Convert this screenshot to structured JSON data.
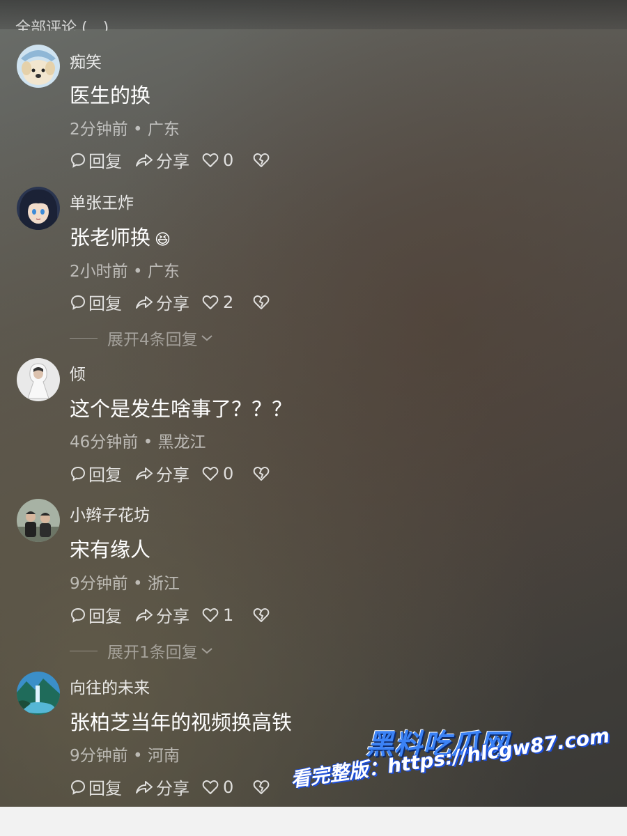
{
  "header": {
    "partial_text": "全部评论 (…)"
  },
  "actions": {
    "reply_label": "回复",
    "share_label": "分享"
  },
  "comments": [
    {
      "username": "痴笑",
      "content": "医生的换",
      "time": "2分钟前",
      "location": "广东",
      "likes": "0",
      "avatar": "dog-avatar"
    },
    {
      "username": "单张王炸",
      "content": "张老师换",
      "time": "2小时前",
      "location": "广东",
      "likes": "2",
      "avatar": "anime-avatar",
      "emoji": "😆",
      "expand_label": "展开4条回复"
    },
    {
      "username": "倾",
      "content": "这个是发生啥事了？？？",
      "time": "46分钟前",
      "location": "黑龙江",
      "likes": "0",
      "avatar": "figure-avatar"
    },
    {
      "username": "小辫子花坊",
      "content": "宋有缘人",
      "time": "9分钟前",
      "location": "浙江",
      "likes": "1",
      "avatar": "kids-avatar",
      "expand_label": "展开1条回复"
    },
    {
      "username": "向往的未来",
      "content": "张柏芝当年的视频换高铁",
      "time": "9分钟前",
      "location": "河南",
      "likes": "0",
      "avatar": "landscape-avatar"
    }
  ],
  "watermark": {
    "brand": "黑料吃瓜网",
    "url_text": "看完整版：https://hlcgw87.com"
  },
  "colors": {
    "text": "#ffffff",
    "meta": "#a9a9a9",
    "brand": "#3b82f6"
  }
}
